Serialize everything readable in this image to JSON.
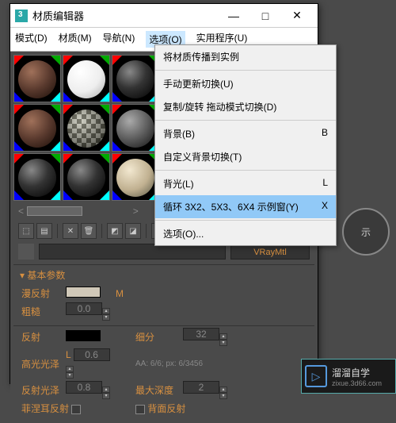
{
  "floating": {
    "label": "示"
  },
  "window": {
    "title": "材质编辑器",
    "controls": {
      "min": "—",
      "max": "□",
      "close": "✕"
    }
  },
  "menubar": {
    "mode": "模式(D)",
    "material": "材质(M)",
    "navigate": "导航(N)",
    "options": "选项(O)",
    "utility": "实用程序(U)"
  },
  "dropdown": {
    "propagate": "将材质传播到实例",
    "manual_update": "手动更新切换(U)",
    "copy_rotate": "复制/旋转 拖动模式切换(D)",
    "background": "背景(B)",
    "background_key": "B",
    "custom_bg": "自定义背景切换(T)",
    "backlight": "背光(L)",
    "backlight_key": "L",
    "cycle": "循环 3X2、5X3、6X4 示例窗(Y)",
    "cycle_key": "X",
    "options_item": "选项(O)..."
  },
  "scroll": {
    "left": "<",
    "right": ">"
  },
  "material": {
    "type": "VRayMtl"
  },
  "rollouts": {
    "basic_title": "基本参数",
    "diffuse": "漫反射",
    "diffuse_m": "M",
    "roughness": "粗糙",
    "rough_val": "0.0",
    "reflect": "反射",
    "subdivs": "细分",
    "subdivs_val": "32",
    "hilite": "高光光泽",
    "hilite_val": "0.6",
    "hilite_lock": "L",
    "aa_text": "AA: 6/6; px: 6/3456",
    "refl_gloss": "反射光泽",
    "refl_val": "0.8",
    "max_depth": "最大深度",
    "max_depth_val": "2",
    "fresnel": "菲涅耳反射",
    "back_label": "背面反射"
  },
  "brand": {
    "name": "溜溜自学",
    "url": "zixue.3d66.com"
  }
}
